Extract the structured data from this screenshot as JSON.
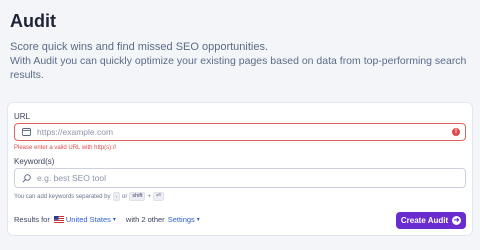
{
  "header": {
    "title": "Audit",
    "subtitle_line1": "Score quick wins and find missed SEO opportunities.",
    "subtitle_line2": "With Audit you can quickly optimize your existing pages based on data from top-performing search results."
  },
  "form": {
    "url_label": "URL",
    "url_placeholder": "https://example.com",
    "url_error": "Please enter a valid URL with http(s)://",
    "keyword_label": "Keyword(s)",
    "keyword_placeholder": "e.g. best SEO tool",
    "hint_prefix": "You can add keywords separated by",
    "hint_key1": ",",
    "hint_or": "or",
    "hint_key2": "shift",
    "hint_plus": "+",
    "hint_key3": "⏎"
  },
  "footer": {
    "results_for": "Results for",
    "country": "United States",
    "with_other": "with 2 other",
    "settings": "Settings",
    "audit_button": "Create Audit"
  },
  "colors": {
    "accent": "#6a2bd0",
    "error": "#e04b4b",
    "link": "#2f5fd8"
  },
  "icons": {
    "url_field": "browser-window-icon",
    "keyword_field": "search-icon",
    "error": "error-icon",
    "flag": "us-flag-icon",
    "button": "arrow-right-circle-icon"
  }
}
